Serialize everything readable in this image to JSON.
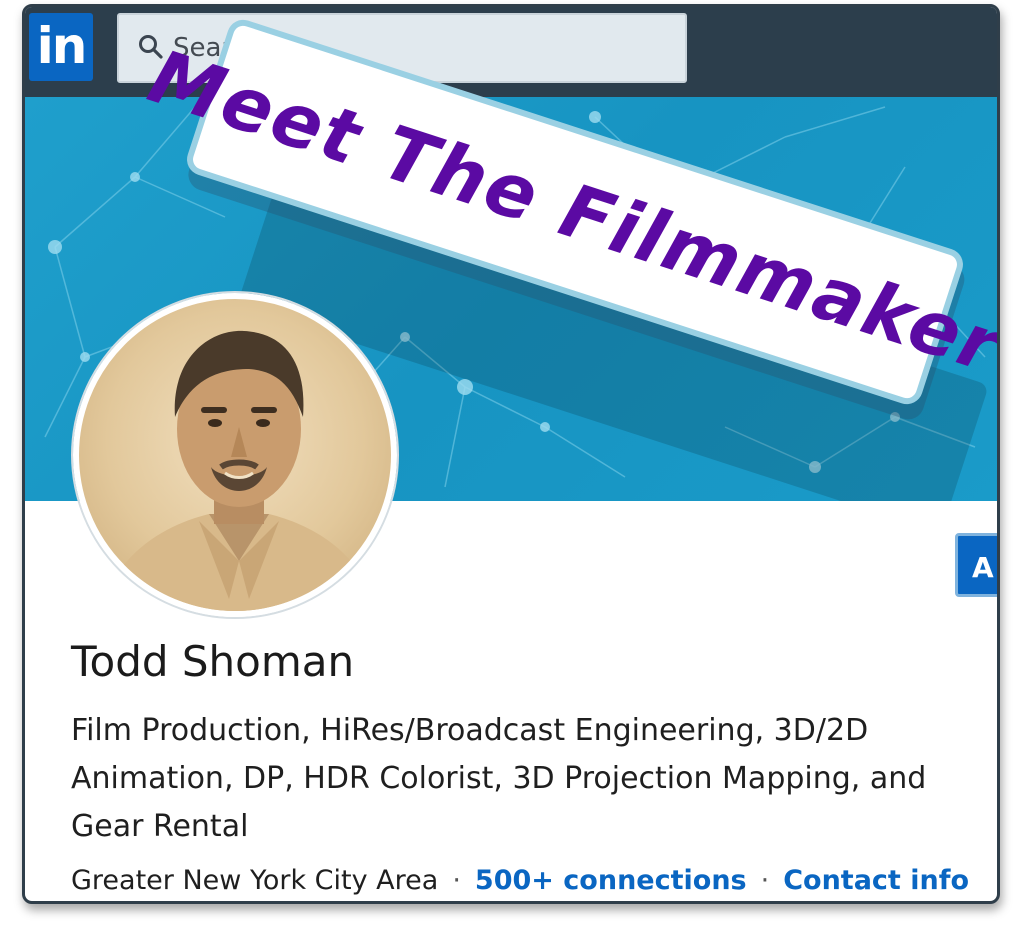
{
  "nav": {
    "logo_text": "in",
    "search_placeholder": "Search"
  },
  "banner": {
    "sign_text": "Meet The Filmmaker"
  },
  "profile": {
    "name": "Todd Shoman",
    "headline_lines": [
      "Film Production, HiRes/Broadcast Engineering, 3D/2D",
      "Animation, DP, HDR Colorist, 3D Projection Mapping, and",
      "Gear Rental"
    ],
    "location": "Greater New York City Area",
    "separator": "·",
    "connections": "500+ connections",
    "contact_info": "Contact info",
    "action_button_partial": "A"
  },
  "colors": {
    "nav_bg": "#2c3e4c",
    "brand_blue": "#0a66c2",
    "banner_blue": "#1a9bc9",
    "sign_text": "#5b0aa3"
  },
  "icons": {
    "search": "search-icon",
    "logo": "linkedin-logo-icon"
  }
}
